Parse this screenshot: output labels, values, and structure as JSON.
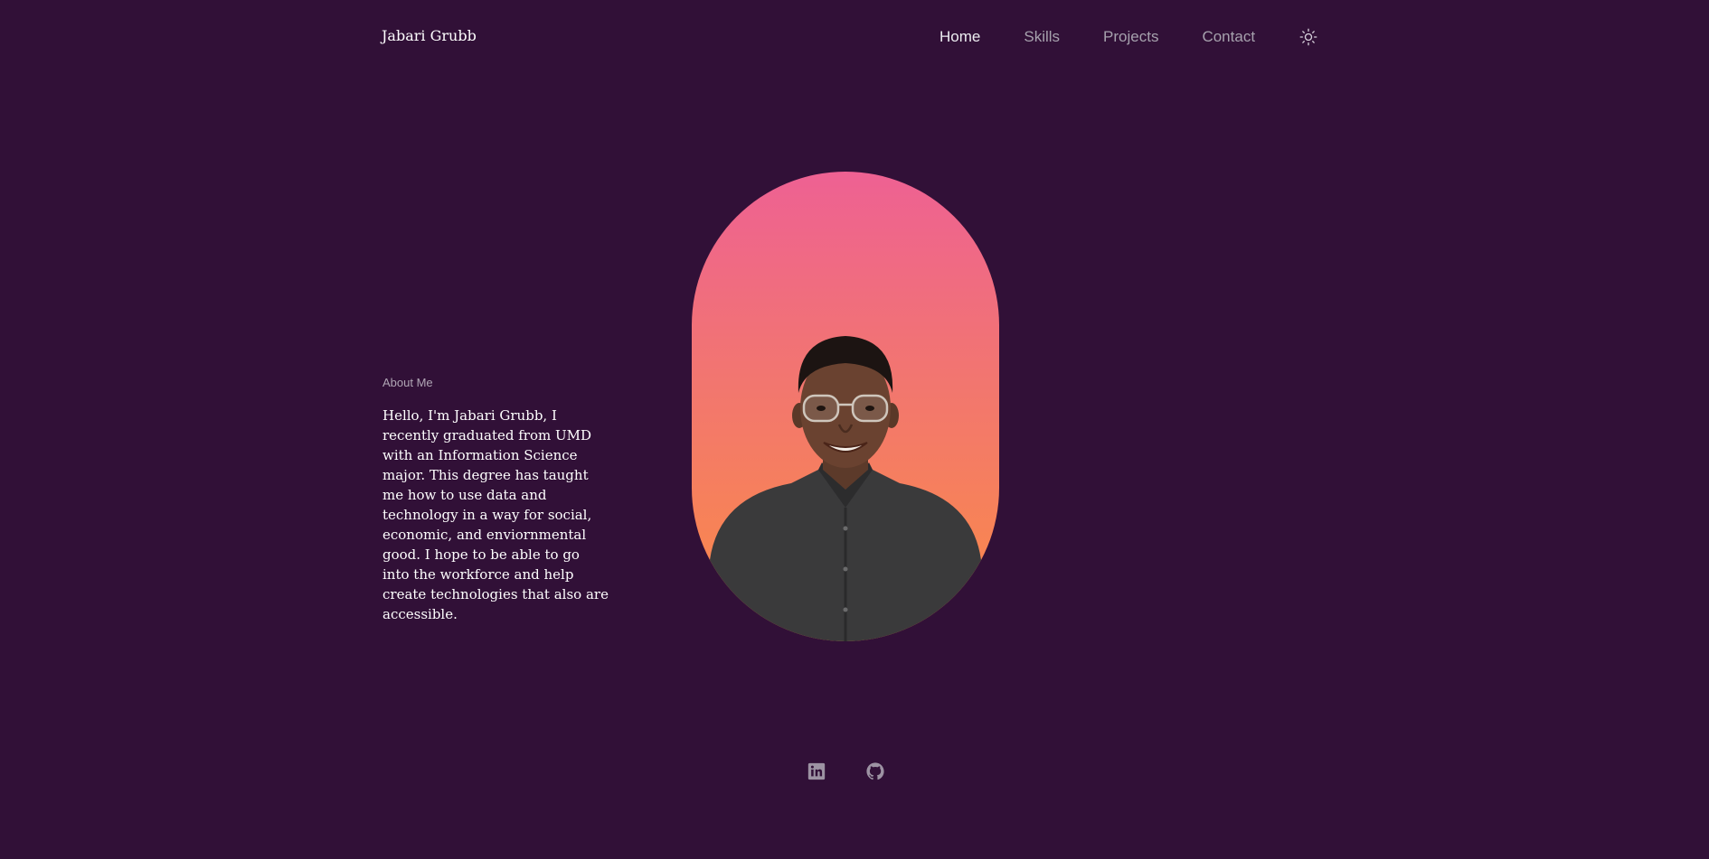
{
  "header": {
    "brand": "Jabari Grubb"
  },
  "nav": {
    "items": [
      {
        "label": "Home",
        "active": true
      },
      {
        "label": "Skills",
        "active": false
      },
      {
        "label": "Projects",
        "active": false
      },
      {
        "label": "Contact",
        "active": false
      }
    ],
    "theme_toggle_icon": "sun-icon"
  },
  "about": {
    "heading": "About Me",
    "text": "Hello, I'm Jabari Grubb, I recently graduated from UMD with an Information Science major. This degree has taught me how to use data and technology in a way for social, economic, and enviornmental good. I hope to be able to go into the workforce and help create technologies that also are accessible."
  },
  "portrait": {
    "gradient_top": "#ee6193",
    "gradient_bottom": "#fb8c45"
  },
  "socials": {
    "icons": [
      "linkedin-icon",
      "github-icon"
    ]
  },
  "colors": {
    "background": "#311037",
    "nav_active": "#ececf0",
    "nav_inactive": "#a6a1ad",
    "icon": "#9d93a3"
  }
}
